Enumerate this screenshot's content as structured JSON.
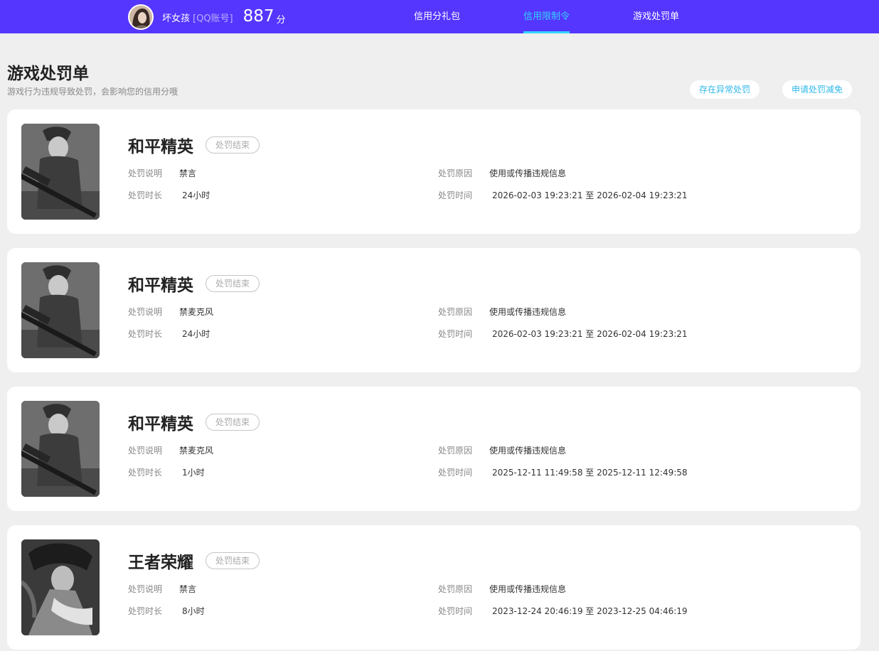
{
  "header": {
    "username": "坏女孩",
    "account_type": "[QQ账号]",
    "score": "887",
    "score_unit": "分",
    "nav": [
      {
        "label": "信用分礼包",
        "active": false
      },
      {
        "label": "信用限制令",
        "active": true
      },
      {
        "label": "游戏处罚单",
        "active": false
      }
    ],
    "active_color": "#35d4ff",
    "bar_color": "#5436ff"
  },
  "page": {
    "title": "游戏处罚单",
    "subtitle": "游戏行为违规导致处罚，会影响您的信用分哦",
    "actions": [
      {
        "label": "存在异常处罚"
      },
      {
        "label": "申请处罚减免"
      }
    ]
  },
  "labels": {
    "desc": "处罚说明",
    "reason": "处罚原因",
    "duration": "处罚时长",
    "time": "处罚时间"
  },
  "records": [
    {
      "game": "和平精英",
      "icon": "peace-elite-game-icon",
      "status": "处罚结束",
      "desc": "禁言",
      "reason": "使用或传播违规信息",
      "duration": "24小时",
      "time": "2026-02-03 19:23:21 至 2026-02-04 19:23:21"
    },
    {
      "game": "和平精英",
      "icon": "peace-elite-game-icon",
      "status": "处罚结束",
      "desc": "禁麦克风",
      "reason": "使用或传播违规信息",
      "duration": "24小时",
      "time": "2026-02-03 19:23:21 至 2026-02-04 19:23:21"
    },
    {
      "game": "和平精英",
      "icon": "peace-elite-game-icon",
      "status": "处罚结束",
      "desc": "禁麦克风",
      "reason": "使用或传播违规信息",
      "duration": "1小时",
      "time": "2025-12-11 11:49:58 至 2025-12-11 12:49:58"
    },
    {
      "game": "王者荣耀",
      "icon": "honor-of-kings-game-icon",
      "status": "处罚结束",
      "desc": "禁言",
      "reason": "使用或传播违规信息",
      "duration": "8小时",
      "time": "2023-12-24 20:46:19 至 2023-12-25 04:46:19"
    }
  ]
}
